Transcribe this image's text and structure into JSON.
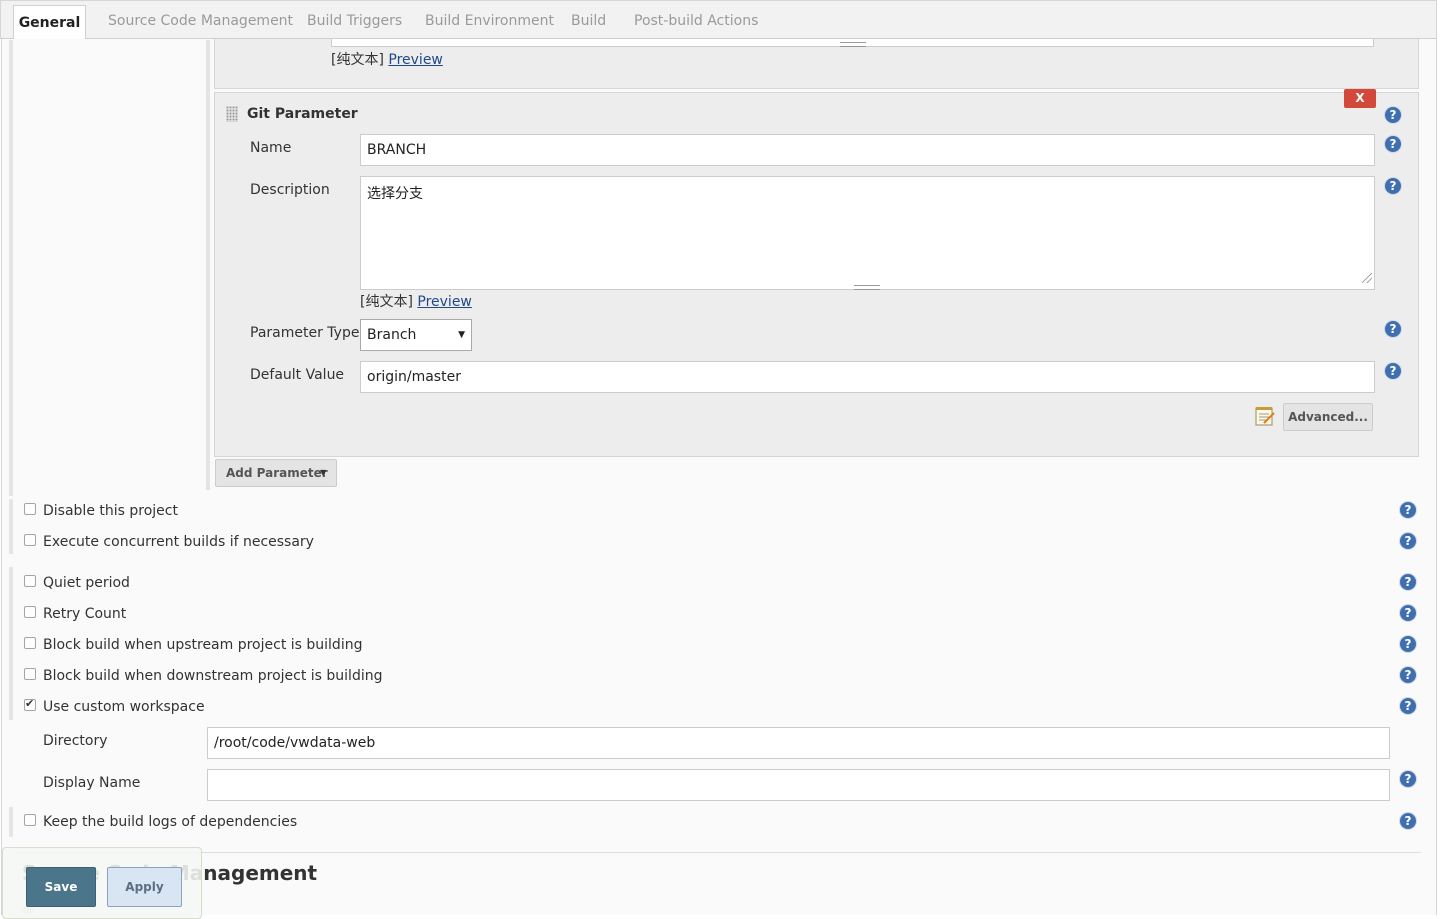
{
  "tabs": [
    {
      "label": "General"
    },
    {
      "label": "Source Code Management"
    },
    {
      "label": "Build Triggers"
    },
    {
      "label": "Build Environment"
    },
    {
      "label": "Build"
    },
    {
      "label": "Post-build Actions"
    }
  ],
  "prev_param": {
    "plain_text": "[纯文本]",
    "preview": "Preview"
  },
  "git_param": {
    "title": "Git Parameter",
    "delete_label": "X",
    "name_label": "Name",
    "name_value": "BRANCH",
    "description_label": "Description",
    "description_value": "选择分支",
    "plain_text": "[纯文本]",
    "preview": "Preview",
    "param_type_label": "Parameter Type",
    "param_type_value": "Branch",
    "default_value_label": "Default Value",
    "default_value": "origin/master",
    "advanced_label": "Advanced..."
  },
  "add_parameter_label": "Add Parameter",
  "options": [
    {
      "label": "Disable this project",
      "checked": false
    },
    {
      "label": "Execute concurrent builds if necessary",
      "checked": false
    },
    {
      "label": "Quiet period",
      "checked": false
    },
    {
      "label": "Retry Count",
      "checked": false
    },
    {
      "label": "Block build when upstream project is building",
      "checked": false
    },
    {
      "label": "Block build when downstream project is building",
      "checked": false
    },
    {
      "label": "Use custom workspace",
      "checked": true
    },
    {
      "label": "Keep the build logs of dependencies",
      "checked": false
    }
  ],
  "workspace": {
    "directory_label": "Directory",
    "directory_value": "/root/code/vwdata-web",
    "display_name_label": "Display Name",
    "display_name_value": ""
  },
  "section_heading": "Source Code Management",
  "footer": {
    "save_label": "Save",
    "apply_label": "Apply"
  },
  "help_glyph": "?",
  "colors": {
    "help": "#3f6fae",
    "delete": "#d24939",
    "save": "#4b758b",
    "apply": "#d8e5f3"
  }
}
